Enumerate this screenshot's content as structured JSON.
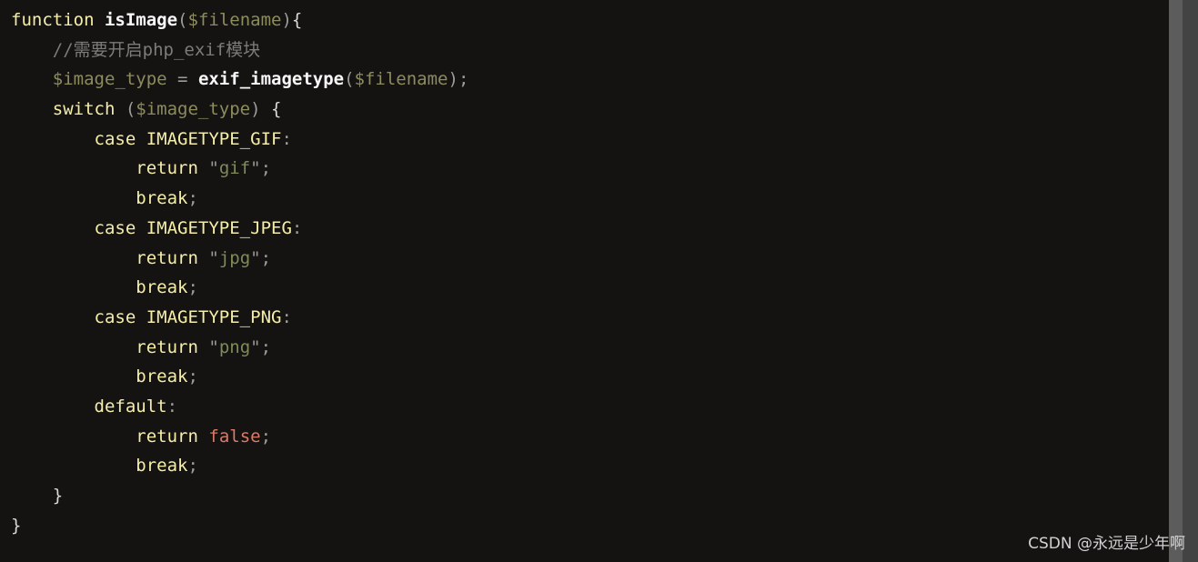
{
  "editor": {
    "language": "php",
    "background_color": "#141312",
    "lines": [
      {
        "indent": 0,
        "tokens": [
          {
            "t": "function",
            "c": "kw"
          },
          {
            "t": " ",
            "c": "punc"
          },
          {
            "t": "isImage",
            "c": "fn"
          },
          {
            "t": "(",
            "c": "punc"
          },
          {
            "t": "$filename",
            "c": "var"
          },
          {
            "t": ")",
            "c": "punc"
          },
          {
            "t": "{",
            "c": "brc"
          }
        ]
      },
      {
        "indent": 4,
        "tokens": [
          {
            "t": "//需要开启php_exif模块",
            "c": "cmt"
          }
        ]
      },
      {
        "indent": 4,
        "tokens": [
          {
            "t": "$image_type",
            "c": "var"
          },
          {
            "t": " = ",
            "c": "punc"
          },
          {
            "t": "exif_imagetype",
            "c": "fn"
          },
          {
            "t": "(",
            "c": "punc"
          },
          {
            "t": "$filename",
            "c": "var"
          },
          {
            "t": ");",
            "c": "punc"
          }
        ]
      },
      {
        "indent": 4,
        "tokens": [
          {
            "t": "switch",
            "c": "kw"
          },
          {
            "t": " (",
            "c": "punc"
          },
          {
            "t": "$image_type",
            "c": "var"
          },
          {
            "t": ") ",
            "c": "punc"
          },
          {
            "t": "{",
            "c": "brc"
          }
        ]
      },
      {
        "indent": 8,
        "tokens": [
          {
            "t": "case",
            "c": "kw"
          },
          {
            "t": " ",
            "c": "punc"
          },
          {
            "t": "IMAGETYPE_GIF",
            "c": "cn"
          },
          {
            "t": ":",
            "c": "punc"
          }
        ]
      },
      {
        "indent": 12,
        "tokens": [
          {
            "t": "return",
            "c": "kw"
          },
          {
            "t": " ",
            "c": "punc"
          },
          {
            "t": "\"",
            "c": "quo"
          },
          {
            "t": "gif",
            "c": "str"
          },
          {
            "t": "\"",
            "c": "quo"
          },
          {
            "t": ";",
            "c": "punc"
          }
        ]
      },
      {
        "indent": 12,
        "tokens": [
          {
            "t": "break",
            "c": "kw"
          },
          {
            "t": ";",
            "c": "punc"
          }
        ]
      },
      {
        "indent": 8,
        "tokens": [
          {
            "t": "case",
            "c": "kw"
          },
          {
            "t": " ",
            "c": "punc"
          },
          {
            "t": "IMAGETYPE_JPEG",
            "c": "cn"
          },
          {
            "t": ":",
            "c": "punc"
          }
        ]
      },
      {
        "indent": 12,
        "tokens": [
          {
            "t": "return",
            "c": "kw"
          },
          {
            "t": " ",
            "c": "punc"
          },
          {
            "t": "\"",
            "c": "quo"
          },
          {
            "t": "jpg",
            "c": "str"
          },
          {
            "t": "\"",
            "c": "quo"
          },
          {
            "t": ";",
            "c": "punc"
          }
        ]
      },
      {
        "indent": 12,
        "tokens": [
          {
            "t": "break",
            "c": "kw"
          },
          {
            "t": ";",
            "c": "punc"
          }
        ]
      },
      {
        "indent": 8,
        "tokens": [
          {
            "t": "case",
            "c": "kw"
          },
          {
            "t": " ",
            "c": "punc"
          },
          {
            "t": "IMAGETYPE_PNG",
            "c": "cn"
          },
          {
            "t": ":",
            "c": "punc"
          }
        ]
      },
      {
        "indent": 12,
        "tokens": [
          {
            "t": "return",
            "c": "kw"
          },
          {
            "t": " ",
            "c": "punc"
          },
          {
            "t": "\"",
            "c": "quo"
          },
          {
            "t": "png",
            "c": "str"
          },
          {
            "t": "\"",
            "c": "quo"
          },
          {
            "t": ";",
            "c": "punc"
          }
        ]
      },
      {
        "indent": 12,
        "tokens": [
          {
            "t": "break",
            "c": "kw"
          },
          {
            "t": ";",
            "c": "punc"
          }
        ]
      },
      {
        "indent": 8,
        "tokens": [
          {
            "t": "default",
            "c": "kw"
          },
          {
            "t": ":",
            "c": "punc"
          }
        ]
      },
      {
        "indent": 12,
        "tokens": [
          {
            "t": "return",
            "c": "kw"
          },
          {
            "t": " ",
            "c": "punc"
          },
          {
            "t": "false",
            "c": "bool"
          },
          {
            "t": ";",
            "c": "punc"
          }
        ]
      },
      {
        "indent": 12,
        "tokens": [
          {
            "t": "break",
            "c": "kw"
          },
          {
            "t": ";",
            "c": "punc"
          }
        ]
      },
      {
        "indent": 4,
        "tokens": [
          {
            "t": "}",
            "c": "brc"
          }
        ]
      },
      {
        "indent": 0,
        "tokens": [
          {
            "t": "}",
            "c": "brc"
          }
        ]
      }
    ]
  },
  "scrollbar": {
    "orientation": "vertical",
    "thumb_position": "top",
    "thumb_color": "#5c5c5c",
    "track_color": "#434343"
  },
  "watermark": {
    "text": "CSDN @永远是少年啊",
    "color": "#d2d2d2"
  }
}
